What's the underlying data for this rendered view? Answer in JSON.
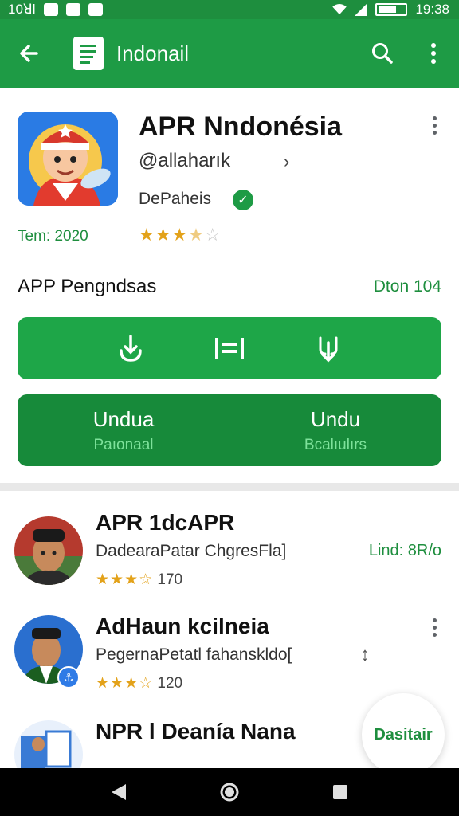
{
  "status_bar": {
    "carrier": "10ꓤl",
    "time": "19:38"
  },
  "app_bar": {
    "title": "Indonail"
  },
  "app": {
    "name": "APR Nndonésia",
    "developer": "@allaharık",
    "category": "DePaheis",
    "year": "Tem: 2020",
    "rating_stars": 3.5
  },
  "section": {
    "title": "APP Pengndsas",
    "count": "Dton 104"
  },
  "download": {
    "left_main": "Undua",
    "left_sub": "Paıonaal",
    "right_main": "Undu",
    "right_sub": "Bcalıulırs"
  },
  "list": [
    {
      "title": "APR 1dcAPR",
      "subtitle": "DadearaPatar ChgresFla]",
      "stars": "★★★☆",
      "rating_count": "170",
      "side": "Lind: 8R/o"
    },
    {
      "title": "AdHaun kcilneia",
      "subtitle": "PegernaPetatl fahanskldo[",
      "stars": "★★★☆",
      "rating_count": "120",
      "side": "↕"
    },
    {
      "title": "NPR l Deanía Nana",
      "subtitle": "",
      "stars": "",
      "rating_count": "",
      "side": ""
    }
  ],
  "fab": {
    "label": "Dasitair"
  },
  "colors": {
    "primary": "#1e9b45",
    "primary_dark": "#178a3a",
    "accent_star": "#e3a21a"
  },
  "icons": {
    "back": "arrow-left-icon",
    "search": "search-icon",
    "more": "more-vert-icon",
    "verified": "check-circle-icon",
    "action1": "touch-download-icon",
    "action2": "list-icon",
    "action3": "share-download-icon"
  }
}
